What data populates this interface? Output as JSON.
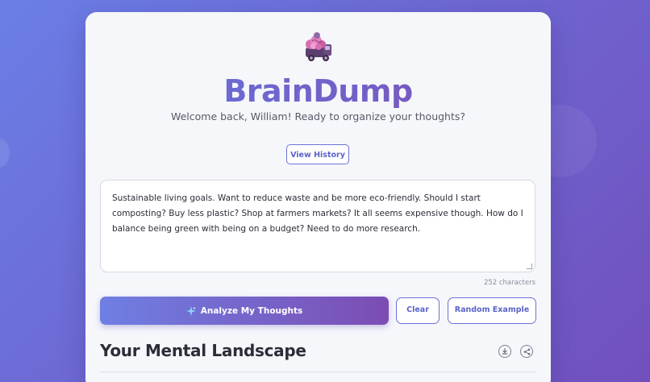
{
  "app": {
    "title": "BrainDump",
    "subtitle": "Welcome back, William! Ready to organize your thoughts?",
    "logo_icon": "brain-truck-logo-icon"
  },
  "toolbar": {
    "history_label": "View History"
  },
  "editor": {
    "value": "Sustainable living goals. Want to reduce waste and be more eco-friendly. Should I start composting? Buy less plastic? Shop at farmers markets? It all seems expensive though. How do I balance being green with being on a budget? Need to do more research.",
    "char_count": "252 characters"
  },
  "actions": {
    "analyze_label": "Analyze My Thoughts",
    "analyze_icon": "sparkle-icon",
    "clear_label": "Clear",
    "random_label": "Random Example"
  },
  "results": {
    "title": "Your Mental Landscape",
    "download_icon": "download-icon",
    "share_icon": "share-icon"
  },
  "colors": {
    "accent": "#6a73d6",
    "gradient_start": "#6f7fe3",
    "gradient_end": "#7c4db3",
    "card_bg": "#f6f7fb"
  }
}
